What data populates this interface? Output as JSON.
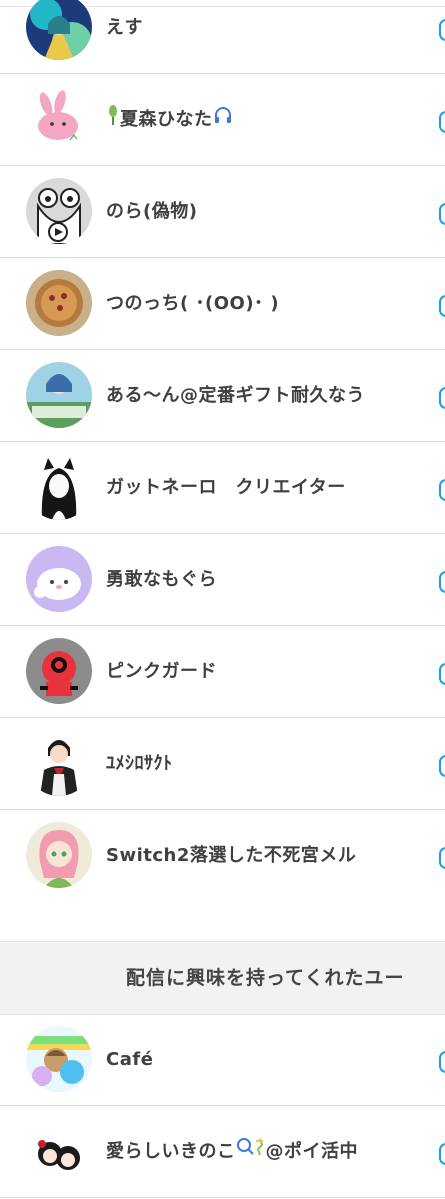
{
  "users_top": [
    {
      "name": "えす",
      "avatar": "anime-girl-avatar"
    },
    {
      "name": "夏森ひなた",
      "prefix_icon": "plant-icon",
      "suffix_icon": "headphones-icon",
      "avatar": "pink-rabbit-avatar"
    },
    {
      "name": "のら(偽物)",
      "avatar": "frog-avatar"
    },
    {
      "name": "つのっち( ･(OO)･ )",
      "avatar": "food-avatar"
    },
    {
      "name": "ある〜ん@定番ギフト耐久なう",
      "avatar": "illustration-avatar"
    },
    {
      "name": "ガットネーロ　クリエイター",
      "avatar": "black-cat-girl-avatar"
    },
    {
      "name": "勇敢なもぐら",
      "avatar": "mole-avatar"
    },
    {
      "name": "ピンクガード",
      "avatar": "pink-guard-avatar"
    },
    {
      "name": "ﾕﾒｼﾛｻｸﾄ",
      "avatar": "boy-in-suit-avatar"
    },
    {
      "name": "Switch2落選した不死宮メル",
      "avatar": "pink-hair-girl-avatar"
    }
  ],
  "section": {
    "title": "配信に興味を持ってくれたユー"
  },
  "users_bottom": [
    {
      "name": "Café",
      "avatar": "cafe-avatar"
    },
    {
      "name": "愛らしいきのこ",
      "suffix_icon": "magnifier-sparkle-icon",
      "suffix_text": "@ポイ活中",
      "avatar": "chibi-girls-avatar"
    }
  ],
  "colors": {
    "accent": "#1aa0e8",
    "separator": "#dcdce6",
    "section_bg": "#f2f2f5"
  }
}
